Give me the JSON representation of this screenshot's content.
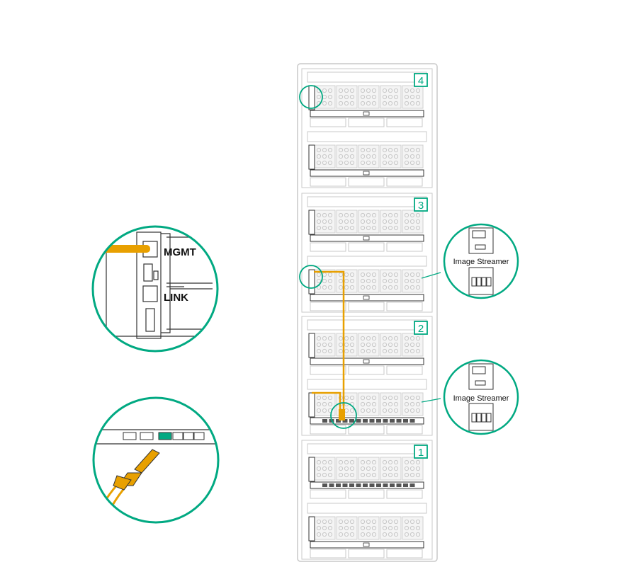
{
  "colors": {
    "accent": "#01a982",
    "cable": "#e8a000",
    "hardware": "#c8c8c8",
    "outline": "#333333"
  },
  "frames": [
    {
      "number": "4"
    },
    {
      "number": "3"
    },
    {
      "number": "2"
    },
    {
      "number": "1"
    }
  ],
  "callouts": {
    "mgmt_link": {
      "mgmt_label": "MGMT",
      "link_label": "LINK"
    },
    "image_streamer_top": {
      "label": "Image Streamer"
    },
    "image_streamer_bottom": {
      "label": "Image Streamer"
    },
    "transceiver": {
      "icon": "transceiver-cable-icon"
    }
  },
  "icons": [
    "frame-link-module-icon",
    "image-streamer-module-icon",
    "transceiver-cable-icon"
  ]
}
